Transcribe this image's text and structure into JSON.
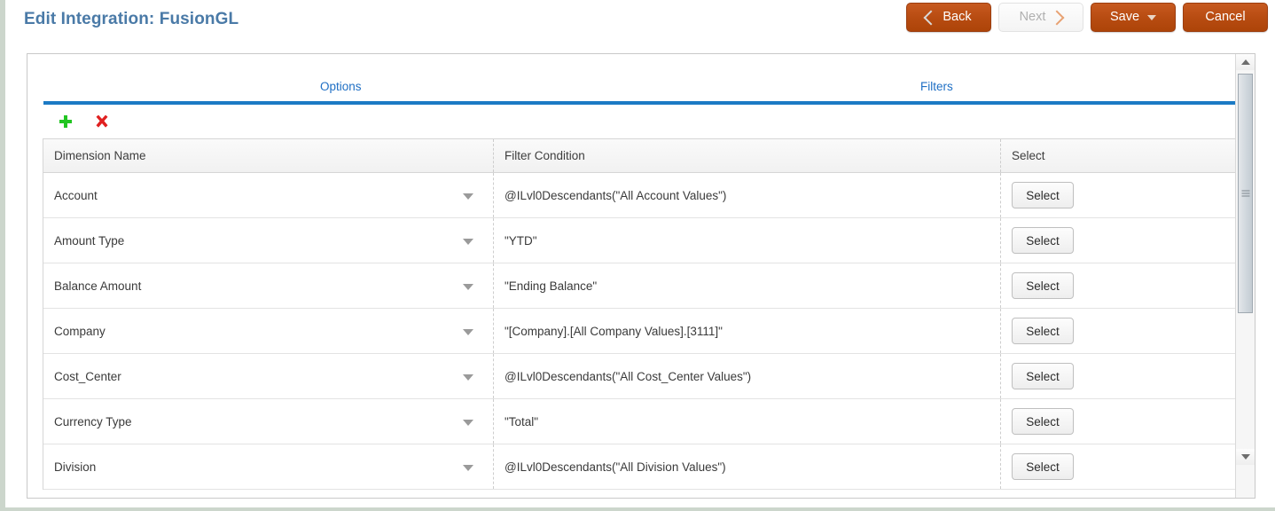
{
  "header": {
    "title": "Edit Integration: FusionGL",
    "title_color": "#4a7aa7",
    "buttons": [
      {
        "label": "Back",
        "icon": "chevron-left-icon",
        "state": "enabled",
        "name": "back-button"
      },
      {
        "label": "Next",
        "icon": "chevron-right-icon",
        "state": "disabled",
        "name": "next-button"
      },
      {
        "label": "Save",
        "icon": "caret-down-icon",
        "state": "enabled",
        "name": "save-button"
      },
      {
        "label": "Cancel",
        "icon": "",
        "state": "enabled",
        "name": "cancel-button"
      }
    ],
    "accent_color": "#b84c12"
  },
  "tabs": [
    {
      "label": "Options",
      "name": "tab-options"
    },
    {
      "label": "Filters",
      "name": "tab-filters"
    }
  ],
  "tab_accent_color": "#1b7ac4",
  "tab_link_color": "#1f6fc4",
  "toolbar": {
    "add_icon": "plus-icon",
    "add_color": "#22c522",
    "delete_icon": "x-icon",
    "delete_color": "#e02020"
  },
  "grid": {
    "columns": [
      "Dimension Name",
      "Filter Condition",
      "Select"
    ],
    "select_button_label": "Select",
    "rows": [
      {
        "dimension": "Account",
        "condition": "@ILvl0Descendants(\"All Account Values\")"
      },
      {
        "dimension": "Amount Type",
        "condition": "\"YTD\""
      },
      {
        "dimension": "Balance Amount",
        "condition": "\"Ending Balance\""
      },
      {
        "dimension": "Company",
        "condition": "\"[Company].[All Company Values].[3111]\""
      },
      {
        "dimension": "Cost_Center",
        "condition": "@ILvl0Descendants(\"All Cost_Center Values\")"
      },
      {
        "dimension": "Currency Type",
        "condition": "\"Total\""
      },
      {
        "dimension": "Division",
        "condition": "@ILvl0Descendants(\"All Division Values\")"
      }
    ]
  },
  "scrollbar": {
    "up_icon": "triangle-up-icon",
    "down_icon": "triangle-down-icon",
    "thumb": "scrollbar-thumb"
  }
}
